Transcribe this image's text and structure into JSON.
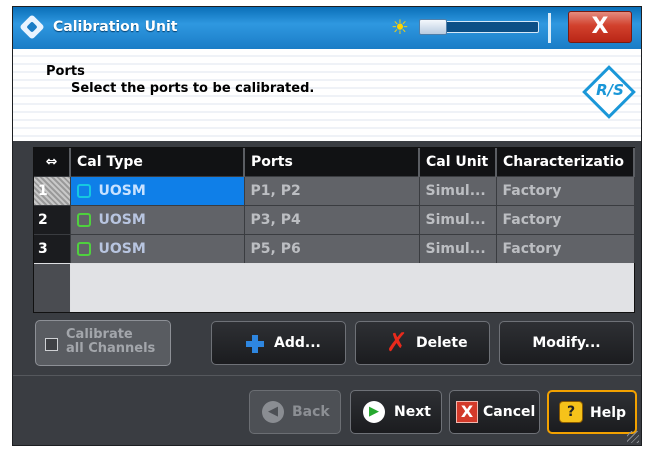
{
  "window": {
    "title": "Calibration Unit",
    "close_label": "X"
  },
  "header": {
    "title": "Ports",
    "subtitle": "Select the ports to be calibrated.",
    "logo_text": "R/S"
  },
  "grid": {
    "corner_icon": "⇔",
    "columns": [
      "Cal Type",
      "Ports",
      "Cal Unit",
      "Characterizatio"
    ],
    "rows": [
      {
        "num": "1",
        "cal_type": "UOSM",
        "ports": "P1, P2",
        "cal_unit": "Simul...",
        "characterization": "Factory"
      },
      {
        "num": "2",
        "cal_type": "UOSM",
        "ports": "P3, P4",
        "cal_unit": "Simul...",
        "characterization": "Factory"
      },
      {
        "num": "3",
        "cal_type": "UOSM",
        "ports": "P5, P6",
        "cal_unit": "Simul...",
        "characterization": "Factory"
      }
    ]
  },
  "buttons": {
    "calibrate_all_line1": "Calibrate",
    "calibrate_all_line2": "all Channels",
    "add": "Add...",
    "delete": "Delete",
    "modify": "Modify...",
    "back": "Back",
    "next": "Next",
    "cancel": "Cancel",
    "help": "Help"
  },
  "icons": {
    "app": "rs-diamond-icon",
    "brightness": "sun-icon",
    "add": "plus-icon",
    "delete": "x-icon",
    "back": "arrow-left-icon",
    "next": "arrow-right-icon",
    "cancel": "cancel-x-icon",
    "help": "help-icon"
  }
}
